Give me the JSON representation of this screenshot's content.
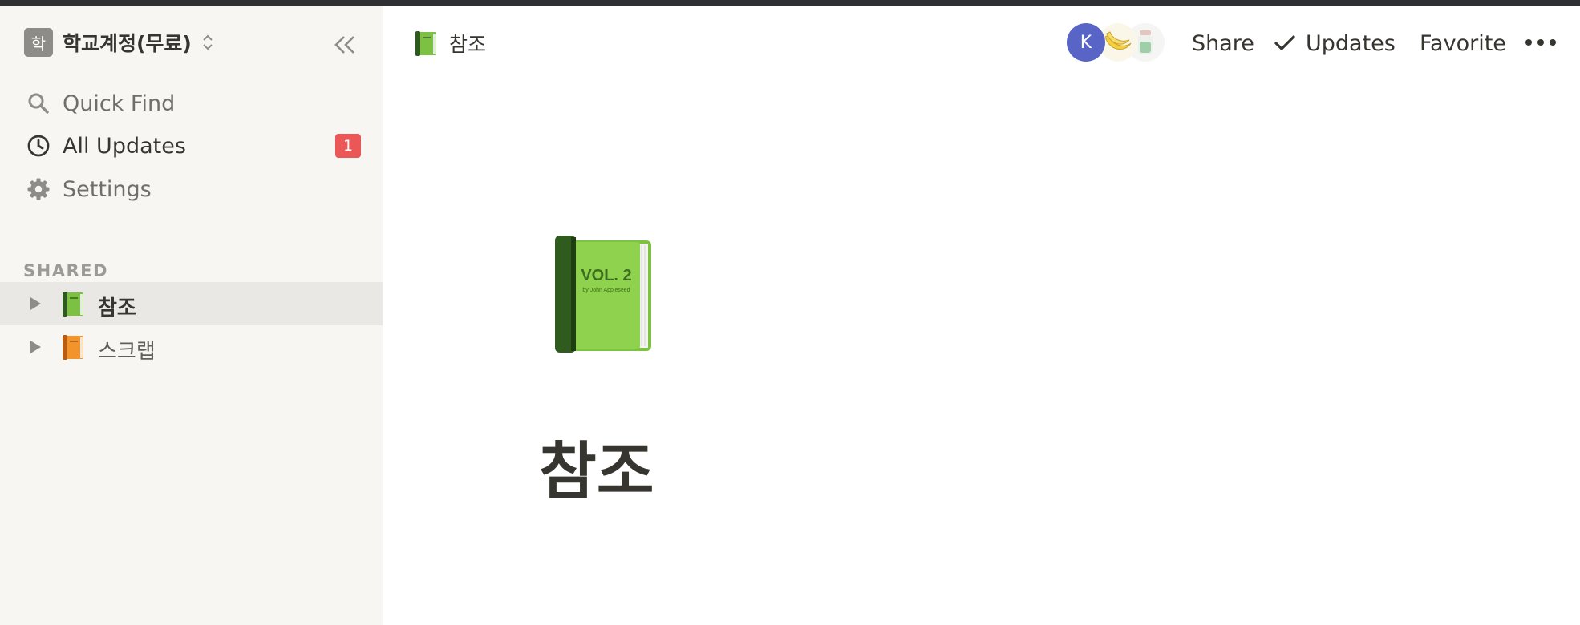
{
  "workspace": {
    "avatar_letter": "학",
    "name": "학교계정(무료)"
  },
  "nav": [
    {
      "label": "Quick Find",
      "icon": "search-icon"
    },
    {
      "label": "All Updates",
      "icon": "clock-icon",
      "badge": "1"
    },
    {
      "label": "Settings",
      "icon": "gear-icon"
    }
  ],
  "sidebar_section": "SHARED",
  "pages": [
    {
      "label": "참조",
      "icon": "green-book-icon",
      "active": true
    },
    {
      "label": "스크랩",
      "icon": "orange-book-icon",
      "active": false
    }
  ],
  "breadcrumb": {
    "label": "참조",
    "icon": "green-book-icon"
  },
  "topbar": {
    "avatar_letter": "K",
    "share_label": "Share",
    "updates_label": "Updates",
    "favorite_label": "Favorite"
  },
  "page": {
    "title": "참조",
    "icon": "green-book-icon",
    "icon_text": "VOL. 2",
    "icon_subtext": "by John Appleseed"
  },
  "colors": {
    "sidebar_bg": "#f7f6f3",
    "active_item_bg": "#e9e8e5",
    "badge": "#eb5757",
    "avatar_k": "#5865c7",
    "text": "#37352f",
    "muted_text": "#6f6e69"
  }
}
